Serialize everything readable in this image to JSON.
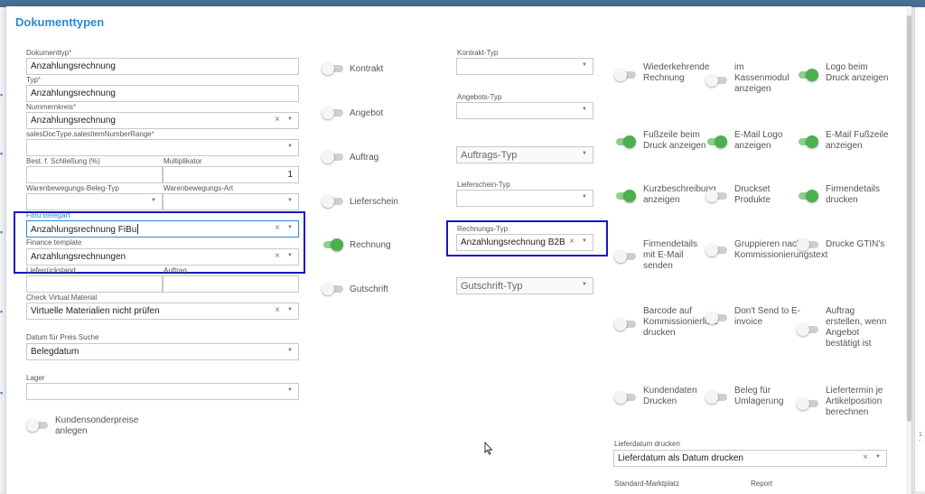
{
  "dialog": {
    "title": "Dokumenttypen"
  },
  "left": {
    "dokumenttyp": {
      "label": "Dokumenttyp",
      "value": "Anzahlungsrechnung"
    },
    "typ": {
      "label": "Typ",
      "value": "Anzahlungsrechnung"
    },
    "nummernkreis": {
      "label": "Nummernkreis",
      "value": "Anzahlungsrechnung"
    },
    "sales_range": {
      "label": "salesDocType.salesItemNumberRange",
      "value": ""
    },
    "schliessung": {
      "label": "Best. f. Schließung (%)",
      "value": ""
    },
    "multiplikator": {
      "label": "Multiplikator",
      "value": "1"
    },
    "beleg_typ": {
      "label": "Warenbewegungs-Beleg-Typ",
      "value": ""
    },
    "warenbewegungs_art": {
      "label": "Warenbewegungs-Art",
      "value": ""
    },
    "fibu_belegart": {
      "label": "FiBu Belegart",
      "value": "Anzahlungsrechnung FiBu"
    },
    "finance_template": {
      "label": "Finance template",
      "value": "Anzahlungsrechnungen"
    },
    "lieferrueckstand": {
      "label": "Lieferrückstand",
      "value": ""
    },
    "auftrag": {
      "label": "Auftrag",
      "value": ""
    },
    "check_virtual": {
      "label": "Check Virtual Material",
      "value": "Virtuelle Materialien nicht prüfen"
    },
    "datum_preis": {
      "label": "Datum für Preis Suche",
      "value": "Belegdatum"
    },
    "lager": {
      "label": "Lager",
      "value": ""
    },
    "kundensonderpreise": {
      "label_line1": "Kundensonderpreise",
      "label_line2": "anlegen"
    }
  },
  "middle_toggles": {
    "kontrakt": "Kontrakt",
    "angebot": "Angebot",
    "auftrag": "Auftrag",
    "lieferschein": "Lieferschein",
    "rechnung": "Rechnung",
    "gutschrift": "Gutschrift"
  },
  "types": {
    "kontrakt_typ": {
      "label": "Kontrakt-Typ",
      "value": ""
    },
    "angebots_typ": {
      "label": "Angebots-Typ",
      "value": ""
    },
    "auftrags_typ": {
      "placeholder": "Auftrags-Typ"
    },
    "lieferschein_typ": {
      "label": "Lieferschein-Typ",
      "value": ""
    },
    "rechnungs_typ": {
      "label": "Rechnungs-Typ",
      "value": "Anzahlungsrechnung B2B"
    },
    "gutschrift_typ": {
      "placeholder": "Gutschrift-Typ"
    }
  },
  "right_toggles": {
    "wiederkehrende": [
      "Wiederkehrende",
      "Rechnung"
    ],
    "kassenmodul": [
      "im",
      "Kassenmodul",
      "anzeigen"
    ],
    "logo_druck": [
      "Logo beim",
      "Druck anzeigen"
    ],
    "fusszeile": [
      "Fußzeile beim",
      "Druck anzeigen"
    ],
    "email_logo": [
      "E-Mail Logo",
      "anzeigen"
    ],
    "email_fusszeile": [
      "E-Mail Fußzeile",
      "anzeigen"
    ],
    "kurzbeschreibung": [
      "Kurzbeschreibung",
      "anzeigen"
    ],
    "druckset": [
      "Druckset",
      "Produkte"
    ],
    "firmendetails_drucken": [
      "Firmendetails",
      "drucken"
    ],
    "firmendetails_email": [
      "Firmendetails",
      "mit E-Mail",
      "senden"
    ],
    "gruppieren": [
      "Gruppieren nach",
      "Kommissionierungstext"
    ],
    "drucke_gtin": [
      "Drucke GTIN's"
    ],
    "barcode": [
      "Barcode auf",
      "Kommissionierliste",
      "drucken"
    ],
    "dont_send": [
      "Don't Send to E-",
      "invoice"
    ],
    "auftrag_erstellen": [
      "Auftrag",
      "erstellen, wenn",
      "Angebot",
      "bestätigt ist"
    ],
    "kundendaten": [
      "Kundendaten",
      "Drucken"
    ],
    "beleg_umlagerung": [
      "Beleg für",
      "Umlagerung"
    ],
    "liefertermin": [
      "Liefertermin je",
      "Artikelposition",
      "berechnen"
    ]
  },
  "bottom": {
    "lieferdatum": {
      "label": "Lieferdatum drucken",
      "value": "Lieferdatum als Datum drucken"
    },
    "standard_marktplatz": {
      "label": "Standard-Marktplatz"
    },
    "report": {
      "label": "Report"
    }
  },
  "icons": {
    "clear": "×",
    "caret": "▼"
  },
  "background": {
    "right_edge_text": "1 -"
  },
  "colors": {
    "accent": "#2a8bd6",
    "toggle_on": "#4caf50",
    "highlight": "#1616c8"
  }
}
